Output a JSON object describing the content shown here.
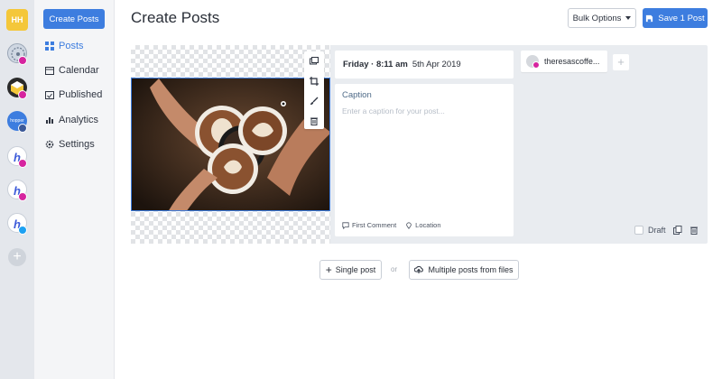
{
  "rail": {
    "workspace_initials": "HH",
    "brand_label": "hopper",
    "accounts": [
      {
        "platform": "instagram"
      },
      {
        "platform": "instagram"
      },
      {
        "platform": "facebook"
      },
      {
        "platform": "instagram"
      },
      {
        "platform": "instagram"
      },
      {
        "platform": "twitter"
      }
    ],
    "add_icon": "plus-icon"
  },
  "nav": {
    "create_label": "Create Posts",
    "items": [
      {
        "label": "Posts",
        "icon": "grid-icon",
        "active": true
      },
      {
        "label": "Calendar",
        "icon": "calendar-icon"
      },
      {
        "label": "Published",
        "icon": "check-calendar-icon"
      },
      {
        "label": "Analytics",
        "icon": "bar-chart-icon"
      },
      {
        "label": "Settings",
        "icon": "gear-icon"
      }
    ]
  },
  "header": {
    "title": "Create Posts",
    "bulk_label": "Bulk Options",
    "save_label": "Save 1 Post"
  },
  "post": {
    "date_day": "Friday · 8:11 am",
    "date_value": "5th Apr 2019",
    "caption_label": "Caption",
    "caption_placeholder": "Enter a caption for your post...",
    "first_comment_label": "First Comment",
    "location_label": "Location",
    "account_name": "theresascoffe...",
    "draft_label": "Draft",
    "image_tools": [
      "gallery-icon",
      "crop-icon",
      "brush-icon",
      "trash-icon"
    ]
  },
  "actions": {
    "single_label": "Single post",
    "or_label": "or",
    "multi_label": "Multiple posts from files"
  },
  "colors": {
    "accent": "#3d7ddf",
    "instagram": "#d6249f",
    "facebook": "#3b5998",
    "twitter": "#1da1f2",
    "workspace": "#f4c73a"
  }
}
